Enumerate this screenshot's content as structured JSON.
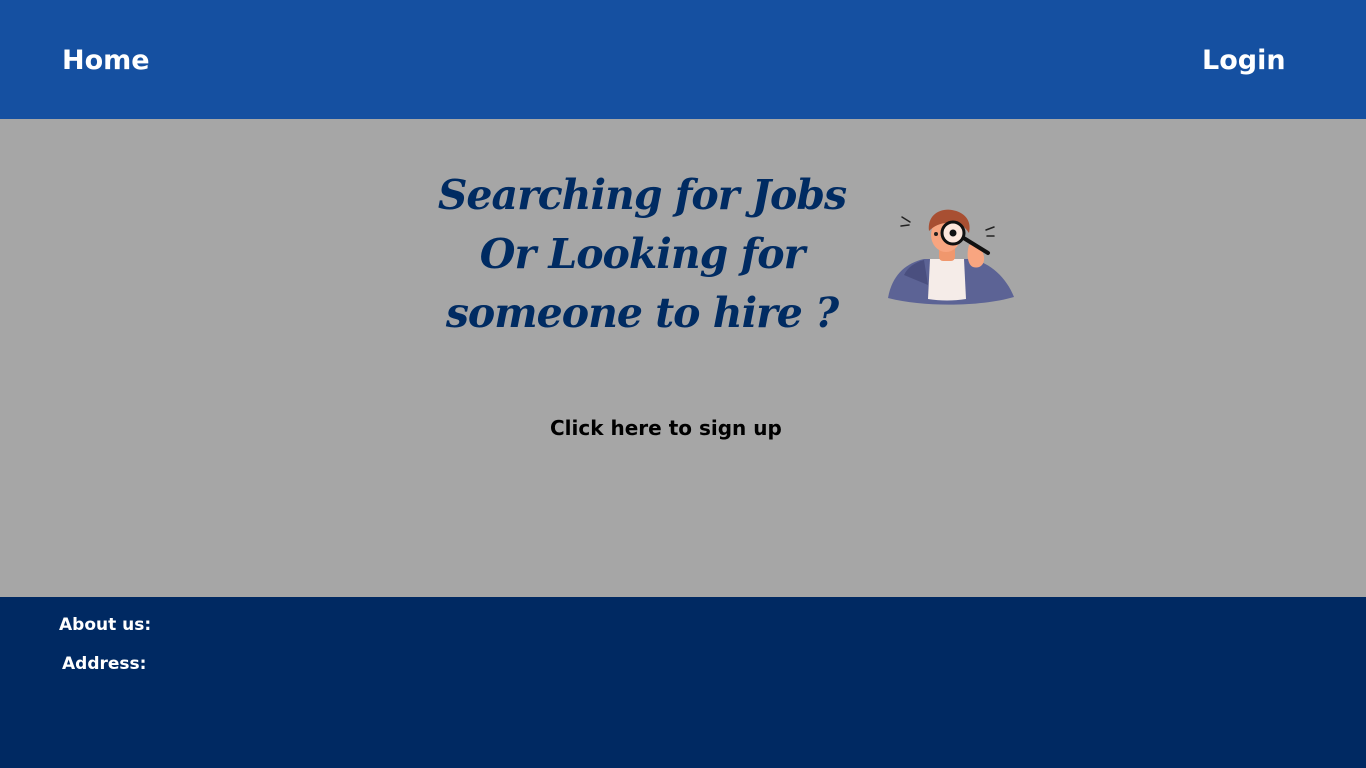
{
  "header": {
    "home_label": "Home",
    "login_label": "Login"
  },
  "hero": {
    "headline_lines": [
      "Searching for Jobs",
      "Or Looking for",
      "someone to hire ?"
    ],
    "illustration_icon": "person-with-magnifying-glass-icon",
    "signup_label": "Click here to sign up"
  },
  "footer": {
    "about_label": "About us:",
    "address_label": "Address:"
  },
  "colors": {
    "header_bg": "#1550a1",
    "hero_bg": "#a6a6a6",
    "headline_text": "#002b62",
    "footer_bg": "#002962"
  }
}
